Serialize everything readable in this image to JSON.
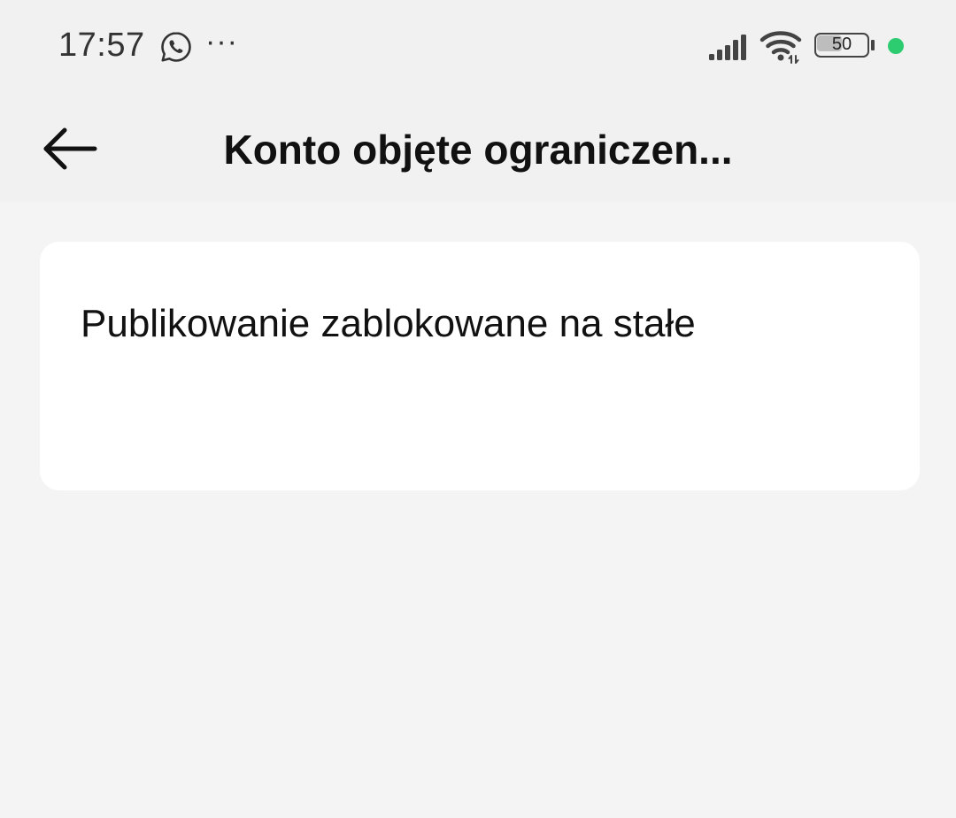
{
  "status_bar": {
    "time": "17:57",
    "more_indicator": "···",
    "battery_level": "50",
    "icons": [
      "whatsapp-icon",
      "signal-icon",
      "wifi-icon",
      "battery-icon"
    ],
    "dot_color": "#2ecc71"
  },
  "header": {
    "back_icon": "arrow-left-icon",
    "title": "Konto objęte ograniczen..."
  },
  "card": {
    "text": "Publikowanie zablokowane na stałe"
  }
}
